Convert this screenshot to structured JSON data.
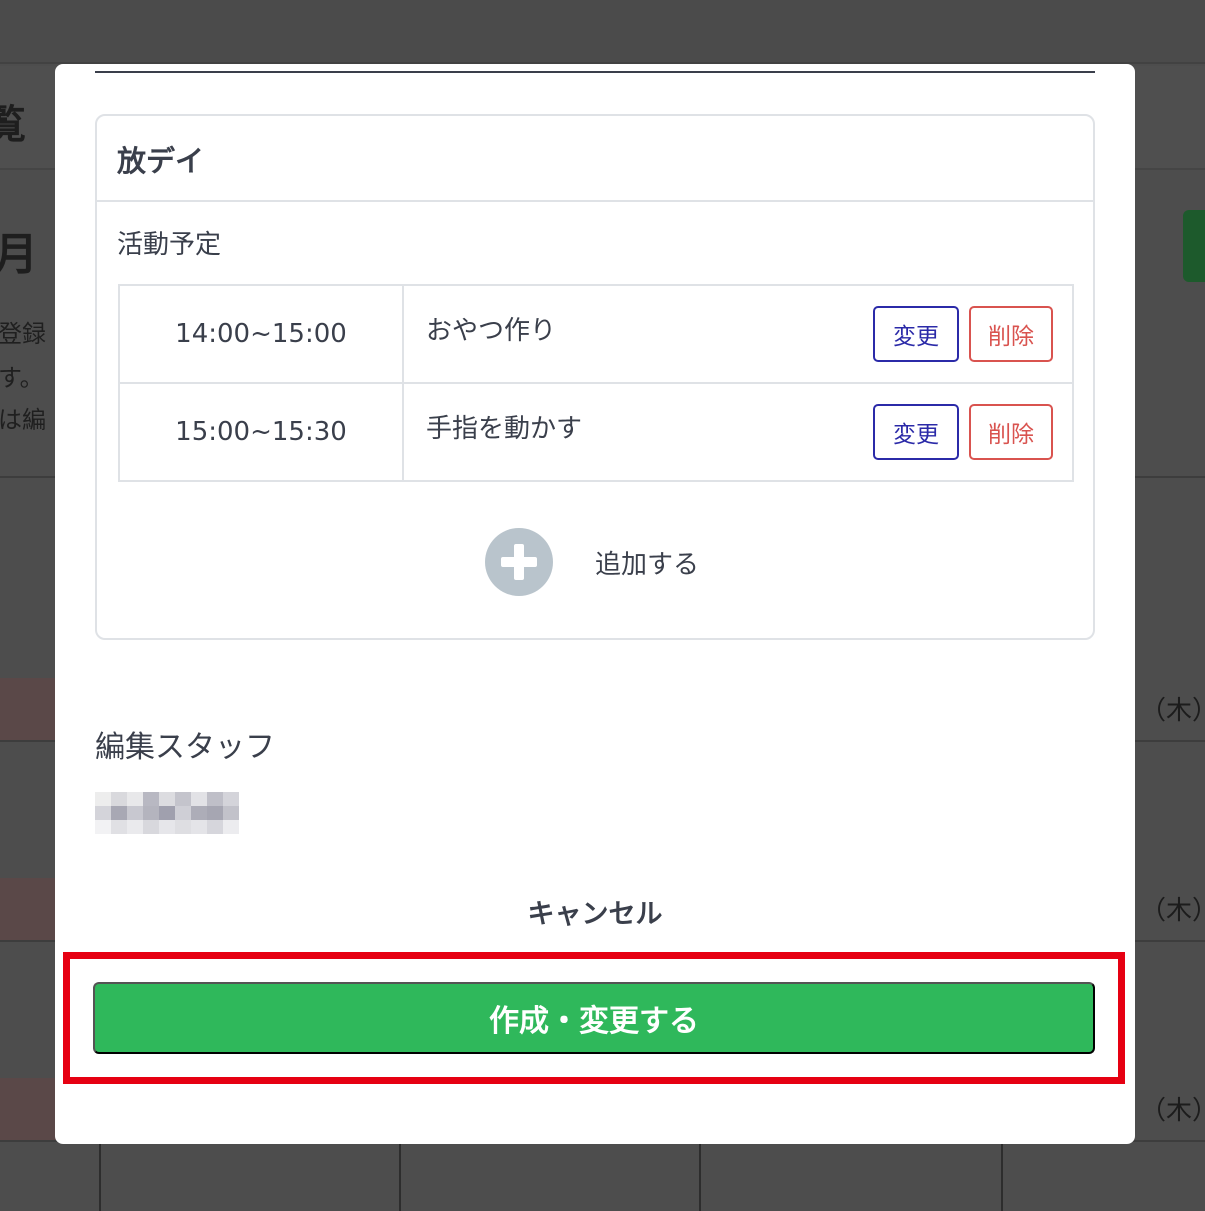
{
  "background": {
    "title_fragment": "覧",
    "month_fragment": "月",
    "notes": [
      "登録",
      "す。",
      "は編"
    ],
    "day_labels": [
      "（木）",
      "（木）",
      "（木）"
    ]
  },
  "modal": {
    "card": {
      "title": "放デイ",
      "section_label": "活動予定",
      "schedule": [
        {
          "time": "14:00~15:00",
          "activity": "おやつ作り",
          "edit_label": "変更",
          "delete_label": "削除"
        },
        {
          "time": "15:00~15:30",
          "activity": "手指を動かす",
          "edit_label": "変更",
          "delete_label": "削除"
        }
      ],
      "add_label": "追加する"
    },
    "staff": {
      "label": "編集スタッフ"
    },
    "cancel_label": "キャンセル",
    "submit_label": "作成・変更する"
  },
  "colors": {
    "primary_green": "#2fb85b",
    "edit_blue": "#2b2aa8",
    "delete_red": "#d9534f",
    "highlight_red": "#e60012"
  }
}
